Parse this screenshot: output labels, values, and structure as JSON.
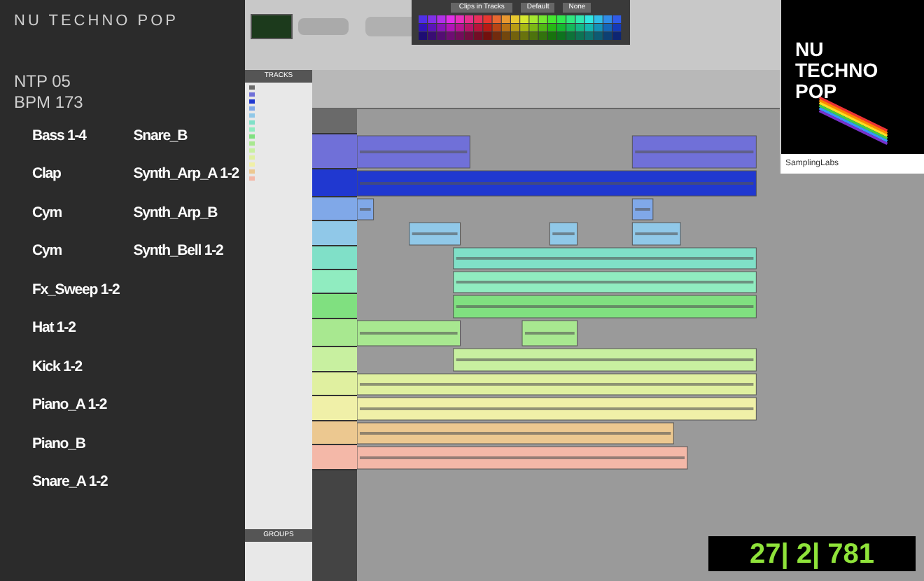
{
  "info": {
    "title": "NU TECHNO POP",
    "code": "NTP 05",
    "bpm": "BPM 173"
  },
  "samples": [
    [
      "Bass 1-4",
      "Clap",
      "Cym",
      "Cym",
      "Fx_Sweep 1-2",
      "Hat 1-2",
      "Kick 1-2",
      "Piano_A 1-2",
      "Piano_B",
      "Snare_A 1-2"
    ],
    [
      "Snare_B",
      "Synth_Arp_A 1-2",
      "Synth_Arp_B",
      "Synth_Bell 1-2"
    ]
  ],
  "daw": {
    "palette": {
      "mode": "Clips in Tracks",
      "buttons": [
        "Default",
        "None"
      ]
    },
    "tracks_header": "TRACKS",
    "groups_header": "GROUPS",
    "tracks": [
      {
        "color": "#6a6a6a"
      },
      {
        "color": "#7070d8"
      },
      {
        "color": "#2038d0"
      },
      {
        "color": "#80a8e8"
      },
      {
        "color": "#90c8e8"
      },
      {
        "color": "#80e0c8"
      },
      {
        "color": "#90ecc0"
      },
      {
        "color": "#80e080"
      },
      {
        "color": "#a8e890"
      },
      {
        "color": "#c8f0a0"
      },
      {
        "color": "#e0f0a0"
      },
      {
        "color": "#f0f0a8"
      },
      {
        "color": "#ecc890"
      },
      {
        "color": "#f4b8a8"
      }
    ],
    "counter": "27| 2| 781"
  },
  "cover": {
    "title_lines": [
      "NU",
      "TECHNO",
      "POP"
    ],
    "label": "SamplingLabs"
  }
}
